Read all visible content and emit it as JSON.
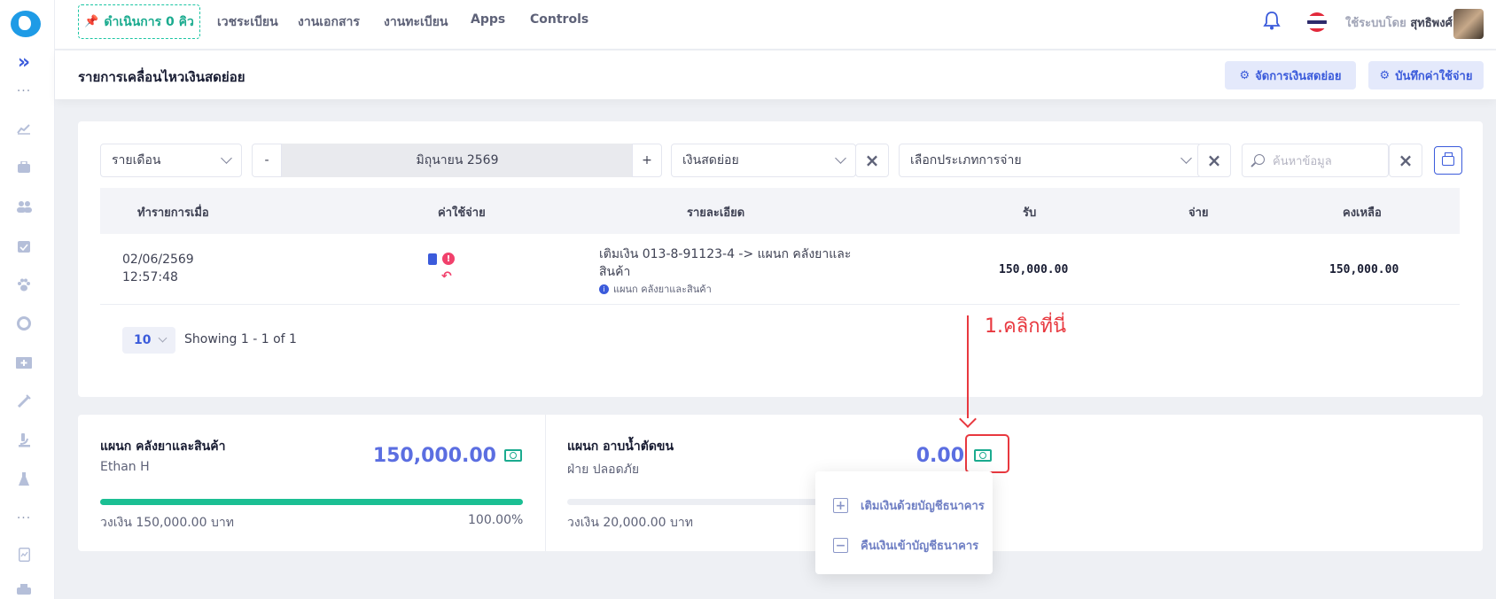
{
  "topbar": {
    "queue_label": "ดำเนินการ 0 คิว",
    "nav": [
      "เวชระเบียน",
      "งานเอกสาร",
      "งานทะเบียน",
      "Apps",
      "Controls"
    ],
    "user_prefix": "ใช้ระบบโดย",
    "user_name": "สุทธิพงศ์"
  },
  "page": {
    "title": "รายการเคลื่อนไหวเงินสดย่อย",
    "btn_manage": "จัดการเงินสดย่อย",
    "btn_record": "บันทึกค่าใช้จ่าย"
  },
  "filters": {
    "period": "รายเดือน",
    "minus": "-",
    "month": "มิถุนายน 2569",
    "plus": "+",
    "fund": "เงินสดย่อย",
    "expense_type_placeholder": "เลือกประเภทการจ่าย",
    "search_placeholder": "ค้นหาข้อมูล"
  },
  "table": {
    "headers": [
      "ทำรายการเมื่อ",
      "ค่าใช้จ่าย",
      "รายละเอียด",
      "รับ",
      "จ่าย",
      "คงเหลือ"
    ],
    "rows": [
      {
        "date": "02/06/2569",
        "time": "12:57:48",
        "detail_line1": "เติมเงิน 013-8-91123-4 -> แผนก คลังยาและ",
        "detail_line2": "สินค้า",
        "detail_note": "แผนก คลังยาและสินค้า",
        "receive": "150,000.00",
        "pay": "",
        "balance": "150,000.00"
      }
    ]
  },
  "pagination": {
    "page_size": "10",
    "summary": "Showing 1 - 1 of 1"
  },
  "funds": [
    {
      "dept": "แผนก คลังยาและสินค้า",
      "owner": "Ethan H",
      "amount": "150,000.00",
      "limit": "วงเงิน 150,000.00 บาท",
      "percent": "100.00%",
      "fill": 1.0
    },
    {
      "dept": "แผนก อาบน้ำตัดขน",
      "owner": "ฝ่าย ปลอดภัย",
      "amount": "0.00",
      "limit": "วงเงิน 20,000.00 บาท",
      "fill": 0.0
    }
  ],
  "annotation": {
    "text": "1.คลิกที่นี่"
  },
  "menu": {
    "deposit": "เติมเงินด้วยบัญชีธนาคาร",
    "withdraw": "คืนเงินเข้าบัญชีธนาคาร"
  },
  "colors": {
    "accent": "#3b5bdb",
    "success": "#1bbf93",
    "danger": "#e8383f",
    "amount": "#5b6ee1"
  }
}
